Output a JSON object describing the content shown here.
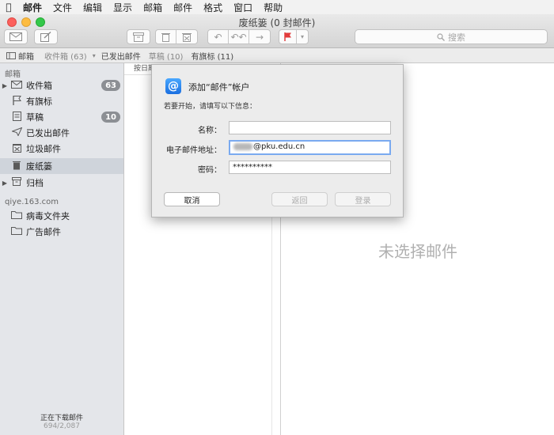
{
  "menubar": {
    "apple_icon": "apple-icon",
    "items": [
      "邮件",
      "文件",
      "编辑",
      "显示",
      "邮箱",
      "邮件",
      "格式",
      "窗口",
      "帮助"
    ]
  },
  "window": {
    "title": "废纸篓 (0 封邮件)"
  },
  "toolbar": {
    "search_placeholder": "搜索"
  },
  "favorites": {
    "mailboxes": "邮箱",
    "inbox": "收件箱 (63)",
    "sent": "已发出邮件",
    "drafts": "草稿 (10)",
    "flagged": "有旗标 (11)"
  },
  "sidebar": {
    "section_mail": "邮箱",
    "items": [
      {
        "label": "收件箱",
        "badge": "63",
        "icon": "inbox-icon"
      },
      {
        "label": "有旗标",
        "icon": "flag-icon"
      },
      {
        "label": "草稿",
        "badge": "10",
        "icon": "draft-icon"
      },
      {
        "label": "已发出邮件",
        "icon": "sent-icon"
      },
      {
        "label": "垃圾邮件",
        "icon": "junk-icon"
      },
      {
        "label": "废纸篓",
        "icon": "trash-icon"
      },
      {
        "label": "归档",
        "icon": "archive-icon"
      }
    ],
    "section_account": "qiye.163.com",
    "account_items": [
      {
        "label": "病毒文件夹",
        "icon": "folder-icon"
      },
      {
        "label": "广告邮件",
        "icon": "folder-icon"
      }
    ],
    "status": "正在下载邮件",
    "count": "694/2,087"
  },
  "message_list": {
    "sort_label": "按日期"
  },
  "preview": {
    "no_selection": "未选择邮件"
  },
  "dialog": {
    "title": "添加“邮件”帐户",
    "subtitle": "若要开始，请填写以下信息：",
    "name_label": "名称：",
    "name_value": "",
    "email_label": "电子邮件地址：",
    "email_value": "@pku.edu.cn",
    "password_label": "密码：",
    "password_value": "**********",
    "cancel": "取消",
    "back": "返回",
    "login": "登录",
    "icon_glyph": "@"
  }
}
